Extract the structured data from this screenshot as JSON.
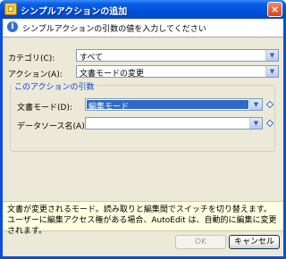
{
  "window": {
    "title": "シンプルアクションの追加",
    "close_label": "×"
  },
  "info": {
    "text": "シンプルアクションの引数の値を入力してください"
  },
  "form": {
    "category_label": "カテゴリ(C):",
    "category_value": "すべて",
    "action_label": "アクション(A):",
    "action_value": "文書モードの変更"
  },
  "arguments": {
    "group_title": "このアクションの引数",
    "doc_mode_label": "文書モード(D):",
    "doc_mode_value": "編集モード",
    "datasource_label": "データソース名(A):",
    "datasource_value": ""
  },
  "description": {
    "text": "文書が変更されるモード。読み取りと編集間でスイッチを切り替えます。ユーザーに編集アクセス権がある場合、AutoEdit は、自動的に編集に変更されます。"
  },
  "buttons": {
    "ok_label": "OK",
    "cancel_label": "キャンセル"
  },
  "icons": {
    "title": "action-dialog-icon",
    "info": "info-icon",
    "dropdown": "chevron-down-icon",
    "field_marker": "diamond-icon"
  }
}
